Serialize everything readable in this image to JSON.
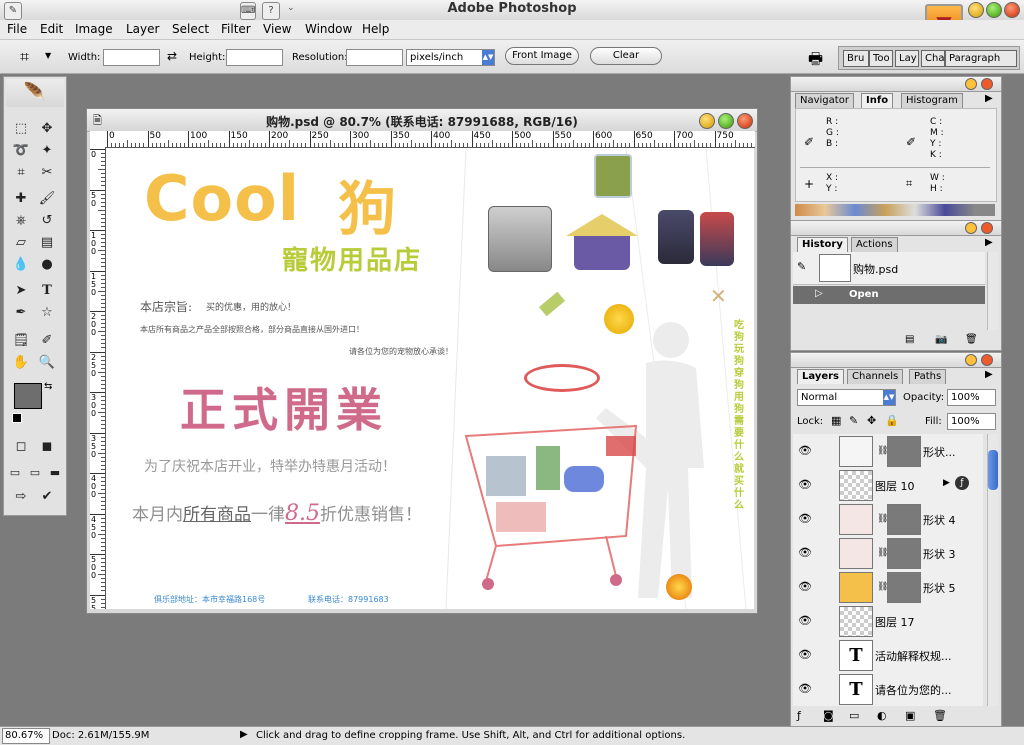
{
  "app": {
    "title": "Adobe Photoshop"
  },
  "menu": [
    "File",
    "Edit",
    "Image",
    "Layer",
    "Select",
    "Filter",
    "View",
    "Window",
    "Help"
  ],
  "options": {
    "width_label": "Width:",
    "height_label": "Height:",
    "resolution_label": "Resolution:",
    "units": "pixels/inch",
    "front_image": "Front Image",
    "clear": "Clear",
    "well_tabs": [
      "Bru",
      "Too",
      "Lay",
      "Cha",
      "Paragraph"
    ]
  },
  "document": {
    "title": "购物.psd @ 80.7% (联系电话:  87991688, RGB/16)",
    "hruler": [
      "0",
      "50",
      "100",
      "150",
      "200",
      "250",
      "300",
      "350",
      "400",
      "450",
      "500",
      "550",
      "600",
      "650",
      "700",
      "750"
    ],
    "vruler": [
      "0",
      "50",
      "100",
      "150",
      "200",
      "250",
      "300",
      "350",
      "400",
      "450",
      "500",
      "550"
    ]
  },
  "canvas": {
    "cool": "Cool",
    "gou": "狗",
    "shop": "寵物用品店",
    "tenet_label": "本店宗旨:",
    "tenet": "买的优惠，用的放心！",
    "line1": "本店所有商品之产品全部按照合格，部分商品直接从国外进口！",
    "line2": "请各位为您的宠物放心承谈！",
    "opening": "正式開業",
    "promo1": "为了庆祝本店开业，特举办特惠月活动！",
    "promo2a": "本月内",
    "promo2b": "所有商品",
    "promo2c": "一律",
    "promo2d": "8.5",
    "promo2e": "折优惠销售！",
    "vertical": "吃狗 玩狗 穿狗 用狗 需要什么 就买什么",
    "footer_addr": "俱乐部地址：本市幸福路168号",
    "footer_phone": "联系电话：87991683"
  },
  "navigator": {
    "tabs": [
      "Navigator",
      "Info",
      "Histogram"
    ],
    "rgb": [
      "R :",
      "G :",
      "B :"
    ],
    "cmyk": [
      "C :",
      "M :",
      "Y :",
      "K :"
    ],
    "xy": [
      "X :",
      "Y :"
    ],
    "wh": [
      "W :",
      "H :"
    ]
  },
  "history": {
    "tabs": [
      "History",
      "Actions"
    ],
    "snapshot": "购物.psd",
    "open": "Open"
  },
  "layers": {
    "tabs": [
      "Layers",
      "Channels",
      "Paths"
    ],
    "blend": "Normal",
    "opacity_label": "Opacity:",
    "opacity": "100%",
    "lock_label": "Lock:",
    "fill_label": "Fill:",
    "fill": "100%",
    "rows": [
      {
        "name": "形状...",
        "kind": "shape"
      },
      {
        "name": "图层 10",
        "kind": "pixel"
      },
      {
        "name": "形状 4",
        "kind": "shape"
      },
      {
        "name": "形状 3",
        "kind": "shape"
      },
      {
        "name": "形状 5",
        "kind": "shape-yellow"
      },
      {
        "name": "图层 17",
        "kind": "pixel"
      },
      {
        "name": "活动解释权规...",
        "kind": "text"
      },
      {
        "name": "请各位为您的...",
        "kind": "text"
      }
    ]
  },
  "status": {
    "zoom": "80.67%",
    "doc": "Doc: 2.61M/155.9M",
    "hint": "Click and drag to define cropping frame. Use Shift, Alt, and Ctrl for additional options."
  },
  "colors": {
    "accent": "#f4c04a",
    "pink": "#d06a8a",
    "green": "#b8cc3a"
  }
}
